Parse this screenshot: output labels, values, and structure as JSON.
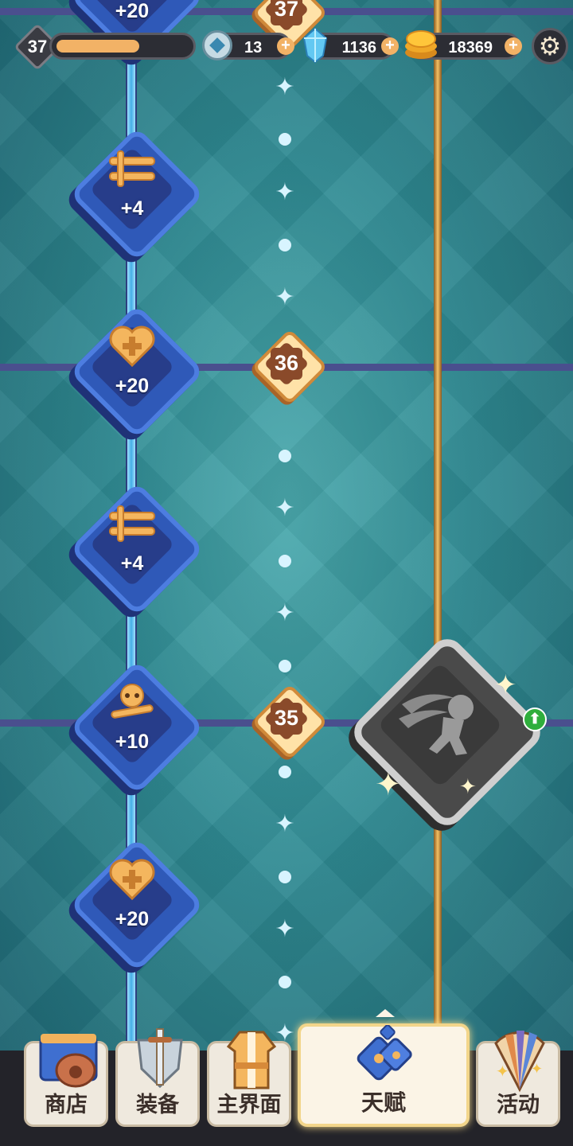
{
  "hud": {
    "player_level": "37",
    "xp_progress": 0.52,
    "crystal_count": "13",
    "gem_count": "1136",
    "gold_count": "18369",
    "settings_icon": "gear-icon"
  },
  "talent_track": {
    "level_badges": [
      "37",
      "36",
      "35"
    ],
    "nodes": [
      {
        "icon": "heart-plus-icon",
        "value": "+20"
      },
      {
        "icon": "crossed-swords-icon",
        "value": "+4"
      },
      {
        "icon": "heart-plus-icon",
        "value": "+20"
      },
      {
        "icon": "crossed-swords-icon",
        "value": "+4"
      },
      {
        "icon": "skull-bones-icon",
        "value": "+10"
      },
      {
        "icon": "heart-plus-icon",
        "value": "+20"
      }
    ],
    "special_skill": {
      "icon": "dash-skill-icon",
      "state": "locked",
      "upgrade_icon": "green-arrow-up-icon"
    }
  },
  "bottom_nav": {
    "tabs": [
      {
        "label": "商店",
        "icon": "shop-bag-icon"
      },
      {
        "label": "装备",
        "icon": "sword-shield-icon"
      },
      {
        "label": "主界面",
        "icon": "armor-icon"
      },
      {
        "label": "天赋",
        "icon": "talent-keys-icon",
        "active": true
      },
      {
        "label": "活动",
        "icon": "events-fan-icon"
      }
    ]
  },
  "colors": {
    "accent_gold": "#f2b266",
    "node_blue": "#2f59b8",
    "track_teal": "#2f8a92"
  }
}
